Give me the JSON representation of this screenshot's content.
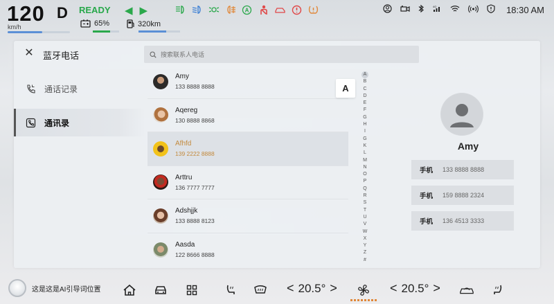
{
  "status": {
    "speed": "120",
    "gear": "D",
    "speed_unit": "km/h",
    "ready": "READY",
    "battery": "65%",
    "range": "320km",
    "time": "18:30 AM"
  },
  "panel": {
    "title": "蓝牙电话",
    "menu": [
      {
        "label": "通话记录",
        "icon": "call-log-icon"
      },
      {
        "label": "通讯录",
        "icon": "contacts-icon"
      }
    ],
    "search_placeholder": "搜索联系人电话",
    "index_letter": "A",
    "index": [
      "A",
      "B",
      "C",
      "D",
      "E",
      "F",
      "G",
      "H",
      "I",
      "G",
      "K",
      "L",
      "M",
      "N",
      "O",
      "P",
      "Q",
      "R",
      "S",
      "T",
      "U",
      "V",
      "W",
      "X",
      "Y",
      "Z",
      "#"
    ],
    "contacts": [
      {
        "name": "Amy",
        "phone": "133 8888 8888"
      },
      {
        "name": "Aqereg",
        "phone": "130 8888 8868"
      },
      {
        "name": "Afhfd",
        "phone": "139 2222 8888"
      },
      {
        "name": "Arttru",
        "phone": "136 7777 7777"
      },
      {
        "name": "Adshjjk",
        "phone": "133 8888 8123"
      },
      {
        "name": "Aasda",
        "phone": "122 8666 8888"
      }
    ],
    "detail": {
      "name": "Amy",
      "phones": [
        {
          "label": "手机",
          "number": "133 8888 8888"
        },
        {
          "label": "手机",
          "number": "159 8888 2324"
        },
        {
          "label": "手机",
          "number": "136 4513 3333"
        }
      ]
    }
  },
  "dock": {
    "ai_text": "这是这是AI引导词位置",
    "temp_left": "20.5°",
    "temp_right": "20.5°"
  },
  "colors": {
    "ready": "#27a84a",
    "selected_text": "#c38a3d",
    "accent_bar": "#5b8fd6"
  }
}
